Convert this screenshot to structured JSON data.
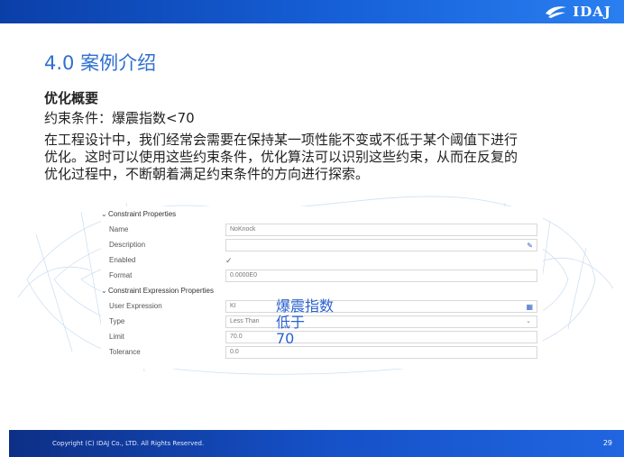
{
  "header": {
    "logo_text": "IDAJ"
  },
  "slide": {
    "title": "4.0 案例介绍",
    "subheading": "优化概要",
    "constraint_line": "约束条件：爆震指数<70",
    "paragraph_lines": [
      "在工程设计中，我们经常会需要在保持某一项性能不变或不低于某个阈值下进行",
      "优化。这时可以使用这些约束条件，优化算法可以识别这些约束，从而在反复的",
      "优化过程中，不断朝着满足约束条件的方向进行探索。"
    ]
  },
  "panel": {
    "section1": "Constraint Properties",
    "name_label": "Name",
    "name_value": "NoKnock",
    "description_label": "Description",
    "description_value": "",
    "enabled_label": "Enabled",
    "enabled_mark": "✓",
    "format_label": "Format",
    "format_value": "0.0000E0",
    "section2": "Constraint Expression Properties",
    "user_expression_label": "User Expression",
    "user_expression_value": "KI",
    "type_label": "Type",
    "type_value": "Less Than",
    "limit_label": "Limit",
    "limit_value": "70.0",
    "tolerance_label": "Tolerance",
    "tolerance_value": "0.0"
  },
  "annotations": {
    "expression": "爆震指数",
    "type": "低于",
    "limit": "70"
  },
  "footer": {
    "copyright": "Copyright (C) IDAJ Co., LTD. All Rights Reserved.",
    "page_number": "29"
  },
  "colors": {
    "title_blue": "#2f6fcf",
    "annotation_blue": "#2a62d0",
    "bar_blue": "#1660d8"
  }
}
